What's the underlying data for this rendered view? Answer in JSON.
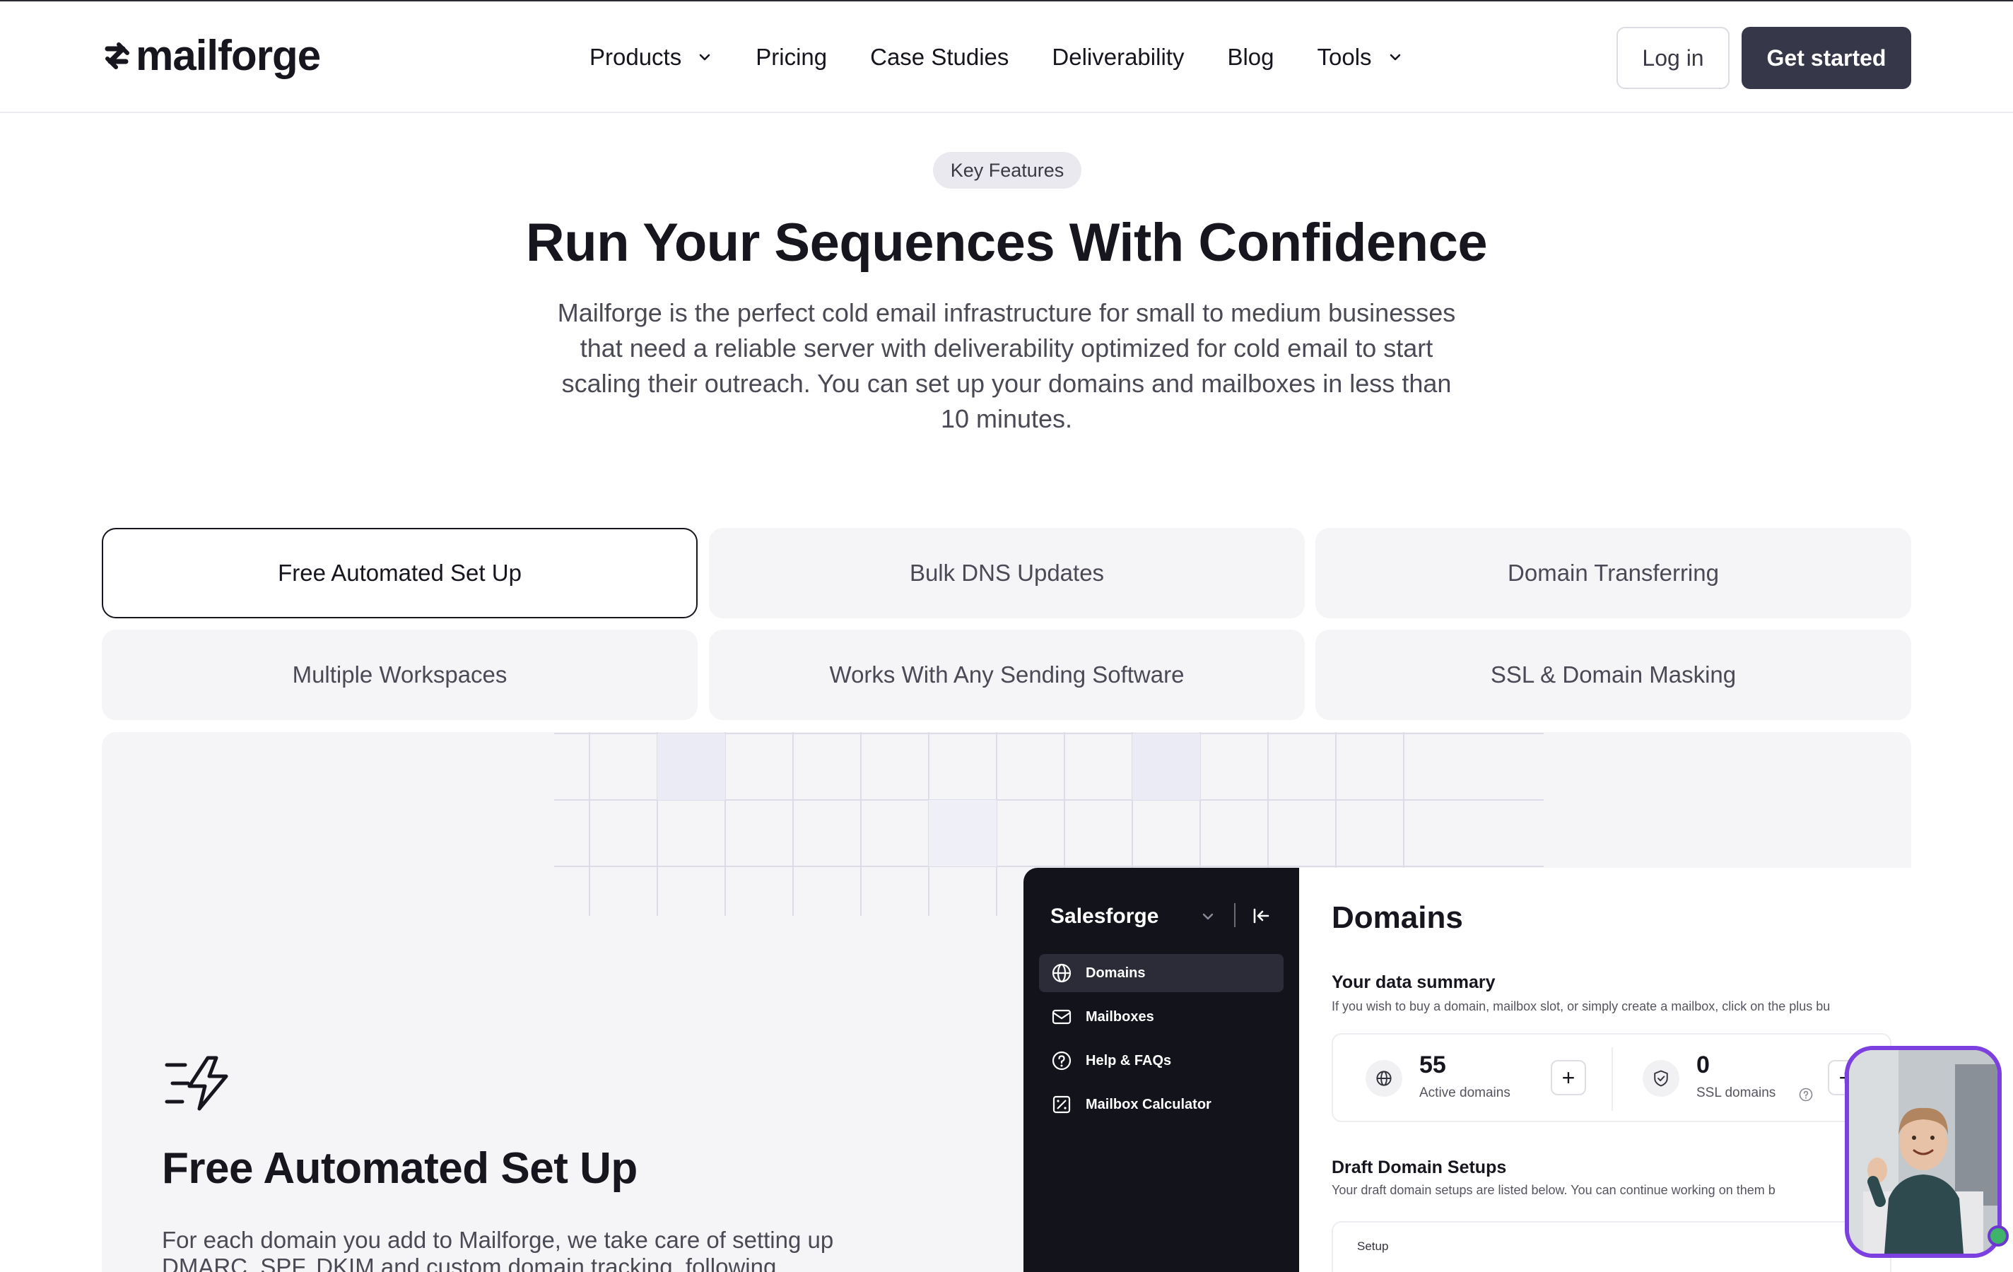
{
  "nav": {
    "logo_text": "mailforge",
    "links": [
      {
        "label": "Products",
        "has_dropdown": true
      },
      {
        "label": "Pricing",
        "has_dropdown": false
      },
      {
        "label": "Case Studies",
        "has_dropdown": false
      },
      {
        "label": "Deliverability",
        "has_dropdown": false
      },
      {
        "label": "Blog",
        "has_dropdown": false
      },
      {
        "label": "Tools",
        "has_dropdown": true
      }
    ],
    "login_label": "Log in",
    "get_started_label": "Get started"
  },
  "hero": {
    "badge": "Key Features",
    "title": "Run Your Sequences With Confidence",
    "description": "Mailforge is the perfect cold email infrastructure for small to medium businesses that need a reliable server with deliverability optimized for cold email to start scaling their outreach. You can set up your domains and mailboxes in less than 10 minutes."
  },
  "tabs": [
    {
      "label": "Free Automated Set Up",
      "active": true
    },
    {
      "label": "Bulk DNS Updates",
      "active": false
    },
    {
      "label": "Domain Transferring",
      "active": false
    },
    {
      "label": "Multiple Workspaces",
      "active": false
    },
    {
      "label": "Works With Any Sending Software",
      "active": false
    },
    {
      "label": "SSL & Domain Masking",
      "active": false
    }
  ],
  "feature": {
    "icon": "fast-lightning-icon",
    "title": "Free Automated Set Up",
    "description": "For each domain you add to Mailforge, we take care of setting up DMARC, SPF, DKIM and custom domain tracking, following"
  },
  "app_mockup": {
    "workspace": "Salesforge",
    "sidebar": [
      {
        "label": "Domains",
        "icon": "globe-icon",
        "active": true
      },
      {
        "label": "Mailboxes",
        "icon": "mail-icon",
        "active": false
      },
      {
        "label": "Help & FAQs",
        "icon": "help-circle-icon",
        "active": false
      },
      {
        "label": "Mailbox Calculator",
        "icon": "calculator-icon",
        "active": false
      }
    ],
    "page_title": "Domains",
    "summary_title": "Your data summary",
    "summary_subtitle": "If you wish to buy a domain, mailbox slot, or simply create a mailbox, click on the plus bu",
    "stats": [
      {
        "value": "55",
        "label": "Active domains",
        "icon": "globe-icon"
      },
      {
        "value": "0",
        "label": "SSL domains",
        "icon": "shield-check-icon"
      }
    ],
    "drafts_title": "Draft Domain Setups",
    "drafts_subtitle": "Your draft domain setups are listed below. You can continue working on them b",
    "setup_label": "Setup"
  },
  "colors": {
    "primary_button": "#363749",
    "tab_background": "#f5f4f7",
    "sidebar_background": "#13131c",
    "video_border": "#7c3fe0",
    "status_online": "#3fb36a"
  }
}
